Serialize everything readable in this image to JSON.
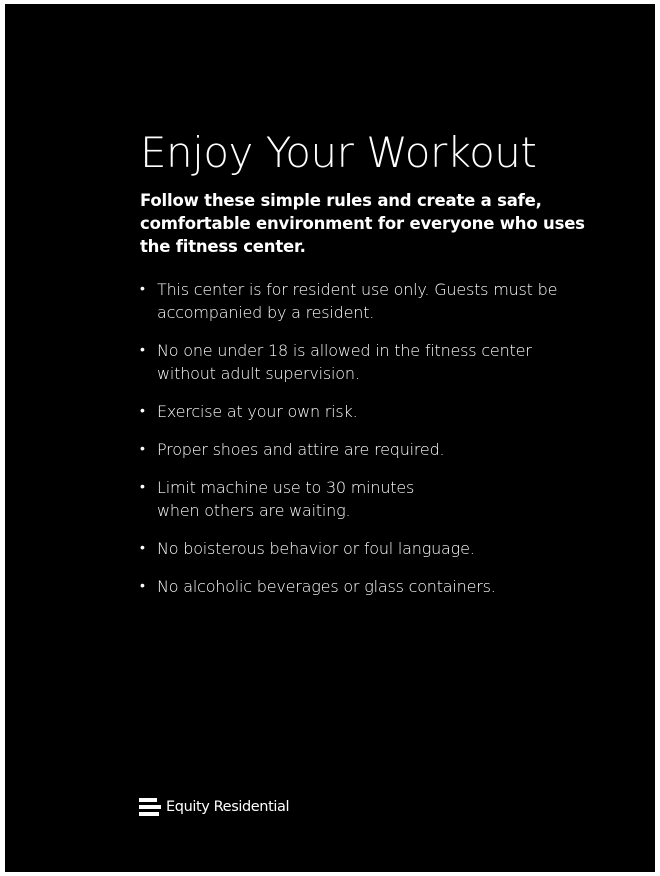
{
  "title": "Enjoy Your Workout",
  "subtitle": "Follow these simple rules and create a safe, comfortable environment for everyone who uses the fitness center.",
  "rules": [
    {
      "bullet": "•",
      "text": "This center is for resident use only. Guests must be\naccompanied by a resident."
    },
    {
      "bullet": "•",
      "text": "No one under 18 is allowed in the fitness center\nwithout adult supervision."
    },
    {
      "bullet": "•",
      "text": "Exercise at your own risk."
    },
    {
      "bullet": "•",
      "text": "Proper shoes and attire are required."
    },
    {
      "bullet": "•",
      "text": "Limit machine use to 30 minutes\nwhen others are waiting."
    },
    {
      "bullet": "•",
      "text": "No boisterous behavior or foul language."
    },
    {
      "bullet": "•",
      "text": "No alcoholic beverages or glass containers."
    }
  ],
  "logo": {
    "icon": "equity-residential-logo-icon",
    "text": "Equity Residential"
  },
  "colors": {
    "background": "#000000",
    "text": "#ffffff",
    "frame": "#ffffff"
  }
}
